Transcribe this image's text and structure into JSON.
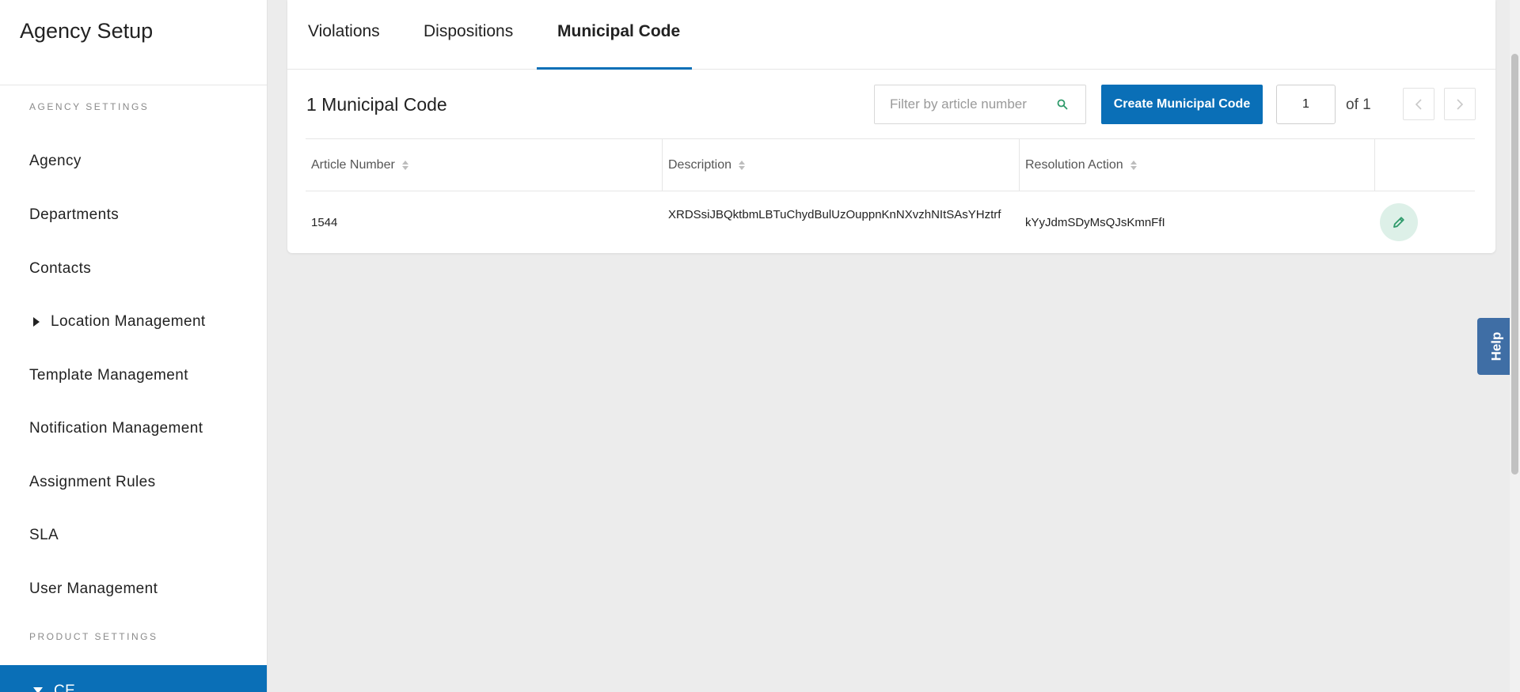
{
  "sidebar": {
    "title": "Agency Setup",
    "agency_settings_label": "AGENCY SETTINGS",
    "items": [
      {
        "label": "Agency"
      },
      {
        "label": "Departments"
      },
      {
        "label": "Contacts"
      },
      {
        "label": "Location Management"
      },
      {
        "label": "Template Management"
      },
      {
        "label": "Notification Management"
      },
      {
        "label": "Assignment Rules"
      },
      {
        "label": "SLA"
      },
      {
        "label": "User Management"
      }
    ],
    "product_settings_label": "PRODUCT SETTINGS",
    "active_item": {
      "label": "CE"
    }
  },
  "tabs": [
    {
      "label": "Violations"
    },
    {
      "label": "Dispositions"
    },
    {
      "label": "Municipal Code",
      "active": true
    }
  ],
  "main": {
    "count_title": "1 Municipal Code",
    "search_placeholder": "Filter by article number",
    "create_button": "Create Municipal Code",
    "page_value": "1",
    "page_of": "of 1"
  },
  "table": {
    "columns": [
      "Article Number",
      "Description",
      "Resolution Action"
    ],
    "rows": [
      {
        "article_number": "1544",
        "description": "XRDSsiJBQktbmLBTuChydBulUzOuppnKnNXvzhNItSAsYHztrf",
        "resolution_action": "kYyJdmSDyMsQJsKmnFfI"
      }
    ]
  },
  "help": {
    "label": "Help"
  },
  "colors": {
    "accent": "#0a6fb7",
    "help_tab": "#3f6ea5",
    "edit_button_bg": "#ddf0e8",
    "edit_icon": "#2e9a6a"
  }
}
